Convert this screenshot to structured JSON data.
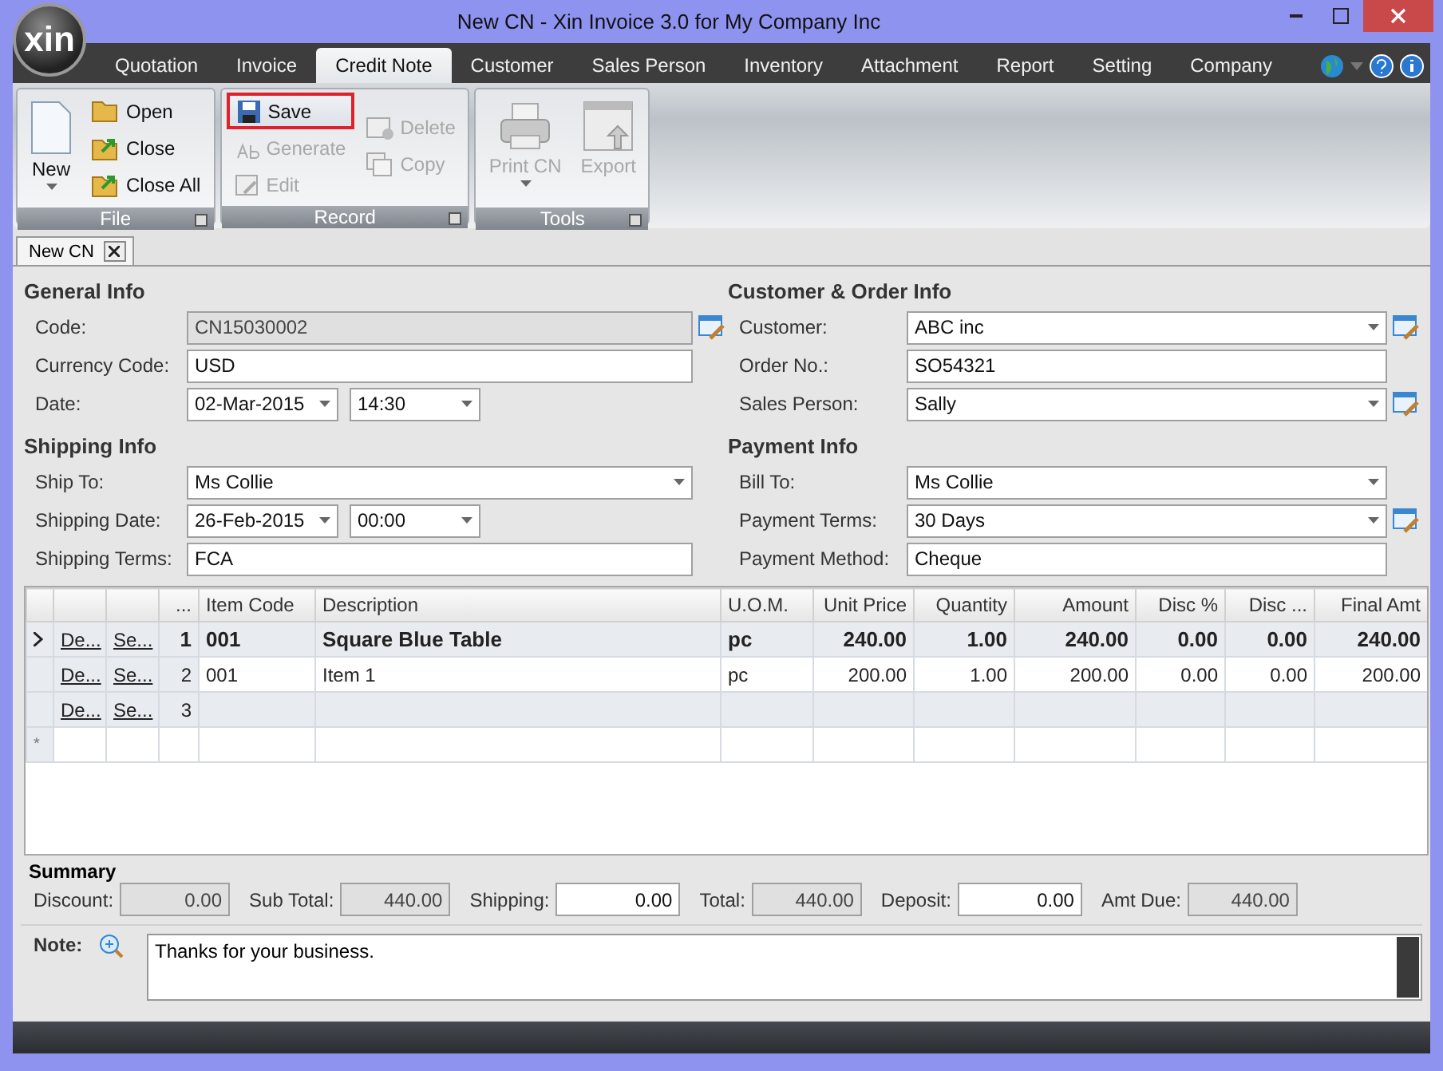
{
  "window": {
    "title": "New CN - Xin Invoice 3.0 for My Company Inc",
    "logo": "xin"
  },
  "menu_tabs": [
    {
      "label": "Quotation",
      "selected": false
    },
    {
      "label": "Invoice",
      "selected": false
    },
    {
      "label": "Credit Note",
      "selected": true
    },
    {
      "label": "Customer",
      "selected": false
    },
    {
      "label": "Sales Person",
      "selected": false
    },
    {
      "label": "Inventory",
      "selected": false
    },
    {
      "label": "Attachment",
      "selected": false
    },
    {
      "label": "Report",
      "selected": false
    },
    {
      "label": "Setting",
      "selected": false
    },
    {
      "label": "Company",
      "selected": false
    }
  ],
  "ribbon": [
    {
      "label": "File",
      "columns": [
        [
          {
            "kind": "large",
            "label": "New",
            "disabled": false,
            "highlighted": false,
            "dropdown": true
          }
        ],
        [
          {
            "kind": "small",
            "label": "Open",
            "disabled": false,
            "highlighted": false
          },
          {
            "kind": "small",
            "label": "Close",
            "disabled": false,
            "highlighted": false
          },
          {
            "kind": "small",
            "label": "Close All",
            "disabled": false,
            "highlighted": false
          }
        ]
      ]
    },
    {
      "label": "Record",
      "columns": [
        [
          {
            "kind": "small",
            "label": "Save",
            "disabled": false,
            "highlighted": true
          },
          {
            "kind": "small",
            "label": "Generate",
            "disabled": true,
            "highlighted": false
          },
          {
            "kind": "small",
            "label": "Edit",
            "disabled": true,
            "highlighted": false
          }
        ],
        [
          {
            "kind": "small",
            "label": "Delete",
            "disabled": true,
            "highlighted": false
          },
          {
            "kind": "small",
            "label": "Copy",
            "disabled": true,
            "highlighted": false
          }
        ]
      ]
    },
    {
      "label": "Tools",
      "columns": [
        [
          {
            "kind": "large",
            "label": "Print CN",
            "disabled": true,
            "highlighted": false,
            "dropdown": true
          }
        ],
        [
          {
            "kind": "large",
            "label": "Export",
            "disabled": true,
            "highlighted": false,
            "dropdown": false
          }
        ]
      ]
    }
  ],
  "document_tab": {
    "label": "New CN"
  },
  "sections": [
    {
      "title": "General Info",
      "fields": [
        {
          "label": "Code:",
          "kind": "readonly",
          "value": "CN15030002",
          "edit_button": true
        },
        {
          "label": "Currency Code:",
          "kind": "text",
          "value": "USD",
          "edit_button": false
        },
        {
          "label": "Date:",
          "kind": "datetime",
          "value": "02-Mar-2015",
          "time": "14:30",
          "edit_button": false
        }
      ]
    },
    {
      "title": "Customer & Order Info",
      "fields": [
        {
          "label": "Customer:",
          "kind": "combo",
          "value": "ABC inc",
          "edit_button": true
        },
        {
          "label": "Order No.:",
          "kind": "text",
          "value": "SO54321",
          "edit_button": false
        },
        {
          "label": "Sales Person:",
          "kind": "combo",
          "value": "Sally",
          "edit_button": true
        }
      ]
    },
    {
      "title": "Shipping Info",
      "fields": [
        {
          "label": "Ship To:",
          "kind": "combo",
          "value": "Ms Collie",
          "edit_button": false
        },
        {
          "label": "Shipping Date:",
          "kind": "datetime",
          "value": "26-Feb-2015",
          "time": "00:00",
          "edit_button": false
        },
        {
          "label": "Shipping Terms:",
          "kind": "text",
          "value": "FCA",
          "edit_button": false
        }
      ]
    },
    {
      "title": "Payment Info",
      "fields": [
        {
          "label": "Bill To:",
          "kind": "combo",
          "value": "Ms Collie",
          "edit_button": false
        },
        {
          "label": "Payment Terms:",
          "kind": "combo",
          "value": "30 Days",
          "edit_button": true
        },
        {
          "label": "Payment Method:",
          "kind": "text",
          "value": "Cheque",
          "edit_button": false
        }
      ]
    }
  ],
  "grid": {
    "columns": [
      "...",
      "Item Code",
      "Description",
      "U.O.M.",
      "Unit Price",
      "Quantity",
      "Amount",
      "Disc %",
      "Disc ...",
      "Final Amt"
    ],
    "rows": [
      {
        "kind": "item",
        "current": true,
        "bold": true,
        "links": [
          "De...",
          "Se..."
        ],
        "cells": [
          "1",
          "001",
          "Square Blue Table",
          "pc",
          "240.00",
          "1.00",
          "240.00",
          "0.00",
          "0.00",
          "240.00"
        ]
      },
      {
        "kind": "item",
        "current": false,
        "bold": false,
        "links": [
          "De...",
          "Se..."
        ],
        "cells": [
          "2",
          "001",
          "Item 1",
          "pc",
          "200.00",
          "1.00",
          "200.00",
          "0.00",
          "0.00",
          "200.00"
        ]
      },
      {
        "kind": "item",
        "current": false,
        "bold": false,
        "links": [
          "De...",
          "Se..."
        ],
        "cells": [
          "3"
        ]
      },
      {
        "kind": "new",
        "marker": "*"
      }
    ]
  },
  "summary": {
    "title": "Summary",
    "fields": [
      {
        "label": "Discount:",
        "value": "0.00",
        "readonly": true
      },
      {
        "label": "Sub Total:",
        "value": "440.00",
        "readonly": true
      },
      {
        "label": "Shipping:",
        "value": "0.00",
        "readonly": false
      },
      {
        "label": "Total:",
        "value": "440.00",
        "readonly": true
      },
      {
        "label": "Deposit:",
        "value": "0.00",
        "readonly": false
      },
      {
        "label": "Amt Due:",
        "value": "440.00",
        "readonly": true
      }
    ]
  },
  "note": {
    "label": "Note:",
    "value": "Thanks for your business."
  }
}
